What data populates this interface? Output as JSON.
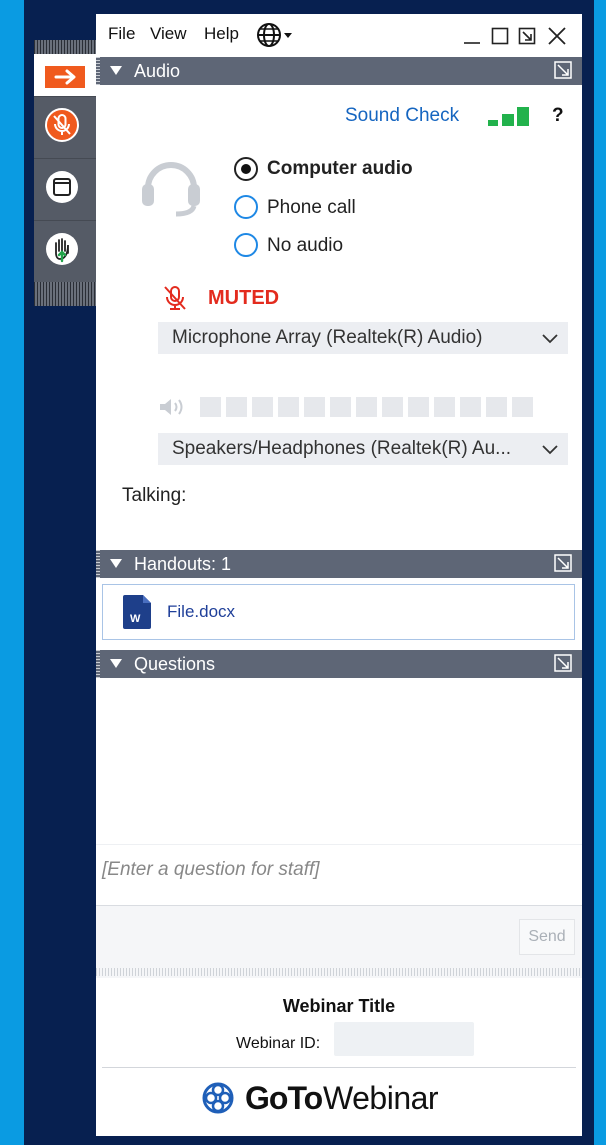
{
  "menu": {
    "file": "File",
    "view": "View",
    "help": "Help"
  },
  "audio": {
    "title": "Audio",
    "sound_check": "Sound Check",
    "help_mark": "?",
    "options": [
      "Computer audio",
      "Phone call",
      "No audio"
    ],
    "selected": "Computer audio",
    "muted_label": "MUTED",
    "microphone": "Microphone Array (Realtek(R) Audio)",
    "speakers": "Speakers/Headphones  (Realtek(R)  Au...",
    "talking_label": "Talking:"
  },
  "handouts": {
    "title": "Handouts: 1",
    "items": [
      {
        "name": "File.docx",
        "icon": "word-doc-icon"
      }
    ]
  },
  "questions": {
    "title": "Questions",
    "placeholder": "[Enter a question for staff]",
    "send_label": "Send"
  },
  "footer": {
    "webinar_title": "Webinar Title",
    "webinar_id_label": "Webinar ID:",
    "brand_bold": "GoTo",
    "brand_regular": "Webinar"
  },
  "colors": {
    "accent_orange": "#f05a1e",
    "mute_red": "#e32b1e",
    "link_blue": "#1565c0",
    "header_gray": "#5e6676",
    "signal_green": "#22b24c"
  }
}
